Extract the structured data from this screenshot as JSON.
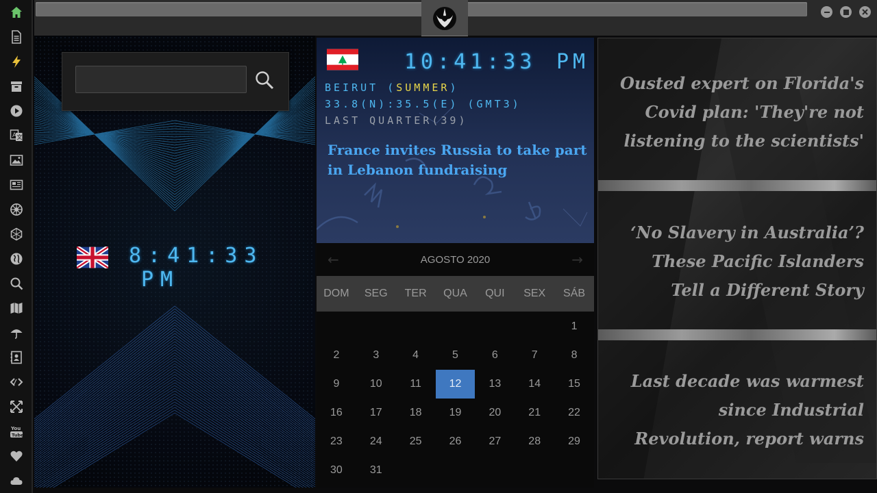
{
  "sidebar": {
    "items": [
      {
        "icon": "home-icon",
        "color": "#6bc46b"
      },
      {
        "icon": "document-icon"
      },
      {
        "icon": "bolt-icon",
        "color": "#e8c03a"
      },
      {
        "icon": "archive-icon"
      },
      {
        "icon": "play-icon"
      },
      {
        "icon": "translate-icon"
      },
      {
        "icon": "image-icon"
      },
      {
        "icon": "newspaper-icon"
      },
      {
        "icon": "rebel-icon"
      },
      {
        "icon": "hexagon-icon"
      },
      {
        "icon": "globe-icon"
      },
      {
        "icon": "search-icon"
      },
      {
        "icon": "map-icon"
      },
      {
        "icon": "umbrella-icon"
      },
      {
        "icon": "contacts-icon"
      },
      {
        "icon": "code-icon"
      },
      {
        "icon": "expand-icon"
      },
      {
        "icon": "youtube-icon"
      },
      {
        "icon": "heart-icon"
      },
      {
        "icon": "cloud-icon"
      }
    ]
  },
  "search": {
    "placeholder": "",
    "value": ""
  },
  "clock_uk": {
    "time": "8:41:33",
    "ampm": "PM"
  },
  "clock_beirut": {
    "time": "10:41:33",
    "ampm": "PM",
    "city": "BEIRUT",
    "season": "SUMMER",
    "coords": "33.8(N):35.5(E) (GMT3)",
    "moon": "LAST QUARTER(39)",
    "headline": "France invites Russia to take part in Lebanon fundraising"
  },
  "calendar": {
    "month_label": "AGOSTO 2020",
    "prev": "←",
    "next": "→",
    "day_names": [
      "DOM",
      "SEG",
      "TER",
      "QUA",
      "QUI",
      "SEX",
      "SÁB"
    ],
    "weeks": [
      [
        "",
        "",
        "",
        "",
        "",
        "",
        "1"
      ],
      [
        "2",
        "3",
        "4",
        "5",
        "6",
        "7",
        "8"
      ],
      [
        "9",
        "10",
        "11",
        "12",
        "13",
        "14",
        "15"
      ],
      [
        "16",
        "17",
        "18",
        "19",
        "20",
        "21",
        "22"
      ],
      [
        "23",
        "24",
        "25",
        "26",
        "27",
        "28",
        "29"
      ],
      [
        "30",
        "31",
        "",
        "",
        "",
        "",
        ""
      ]
    ],
    "selected_day": "12"
  },
  "news": [
    {
      "title": "Ousted expert on Florida's Covid plan: 'They're not listening to the scientists'"
    },
    {
      "title": "‘No Slavery in Australia’? These Pacific Islanders Tell a Different Story"
    },
    {
      "title": "Last decade was warmest since Industrial Revolution, report warns"
    }
  ],
  "colors": {
    "accent": "#4fb8f0",
    "link": "#4aa6f0",
    "season": "#e8d64a",
    "selected": "#3f78c0"
  }
}
